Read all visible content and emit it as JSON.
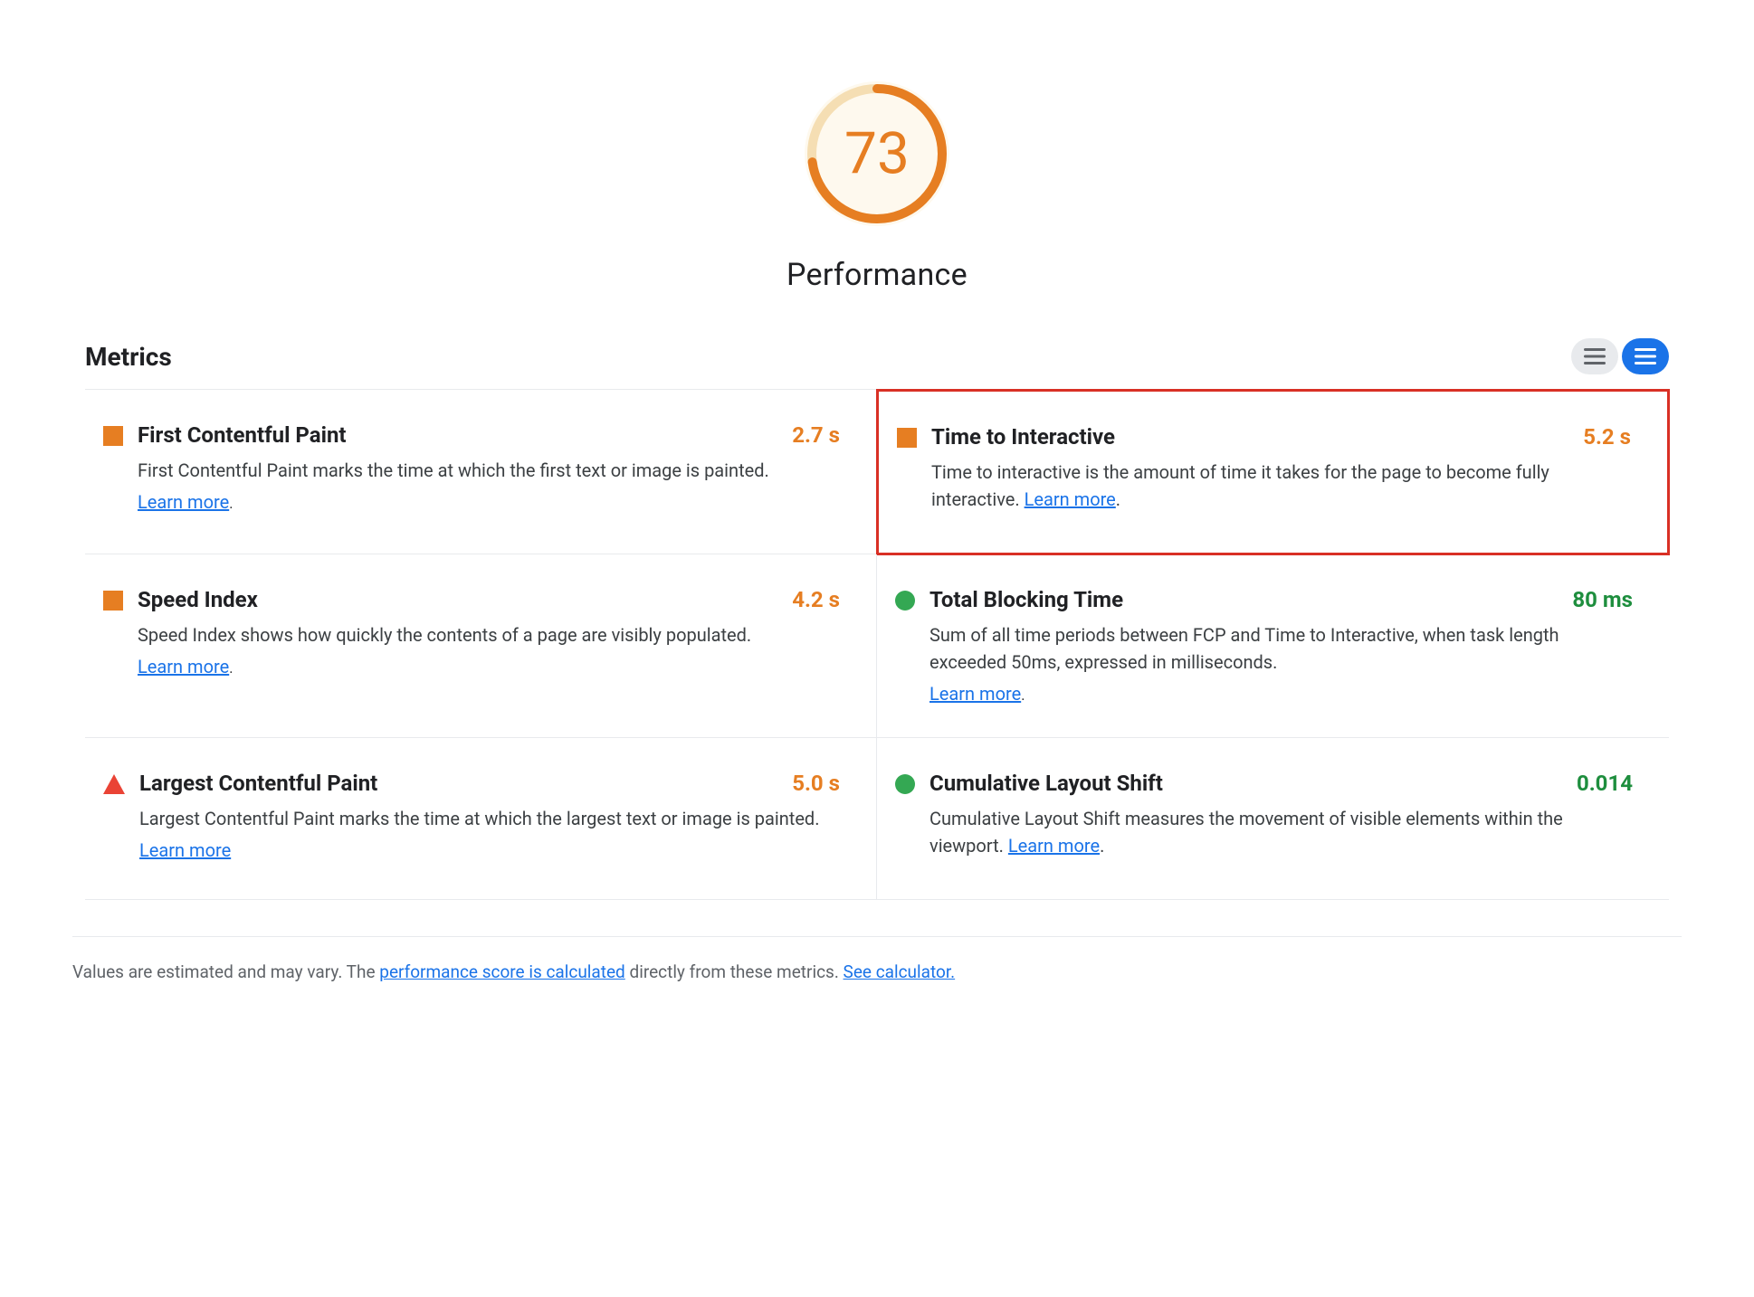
{
  "score": {
    "value": "73",
    "label": "Performance",
    "color": "#e67e22",
    "bgColor": "#fef9ee"
  },
  "metrics": {
    "title": "Metrics",
    "buttons": {
      "list_icon": "≡",
      "detail_icon": "≡"
    },
    "items": [
      {
        "id": "fcp",
        "name": "First Contentful Paint",
        "description": "First Contentful Paint marks the time at which the first text or image is painted.",
        "value": "2.7 s",
        "value_color": "orange",
        "icon": "square-orange",
        "learn_more": "Learn more",
        "highlighted": false,
        "position": "left"
      },
      {
        "id": "tti",
        "name": "Time to Interactive",
        "description": "Time to interactive is the amount of time it takes for the page to become fully interactive.",
        "value": "5.2 s",
        "value_color": "orange",
        "icon": "square-orange",
        "learn_more": "Learn more",
        "highlighted": true,
        "position": "right"
      },
      {
        "id": "si",
        "name": "Speed Index",
        "description": "Speed Index shows how quickly the contents of a page are visibly populated.",
        "value": "4.2 s",
        "value_color": "orange",
        "icon": "square-orange",
        "learn_more": "Learn more",
        "highlighted": false,
        "position": "left"
      },
      {
        "id": "tbt",
        "name": "Total Blocking Time",
        "description": "Sum of all time periods between FCP and Time to Interactive, when task length exceeded 50ms, expressed in milliseconds.",
        "value": "80 ms",
        "value_color": "green",
        "icon": "circle-green",
        "learn_more": "Learn more",
        "highlighted": false,
        "position": "right"
      },
      {
        "id": "lcp",
        "name": "Largest Contentful Paint",
        "description": "Largest Contentful Paint marks the time at which the largest text or image is painted.",
        "value": "5.0 s",
        "value_color": "orange",
        "icon": "triangle-red",
        "learn_more": "Learn more",
        "highlighted": false,
        "position": "left"
      },
      {
        "id": "cls",
        "name": "Cumulative Layout Shift",
        "description": "Cumulative Layout Shift measures the movement of visible elements within the viewport.",
        "value": "0.014",
        "value_color": "green",
        "icon": "circle-green",
        "learn_more": "Learn more",
        "highlighted": false,
        "position": "right"
      }
    ]
  },
  "footer": {
    "text_before": "Values are estimated and may vary. The ",
    "link1_text": "performance score is calculated",
    "text_middle": " directly from these metrics. ",
    "link2_text": "See calculator.",
    "text_after": ""
  }
}
